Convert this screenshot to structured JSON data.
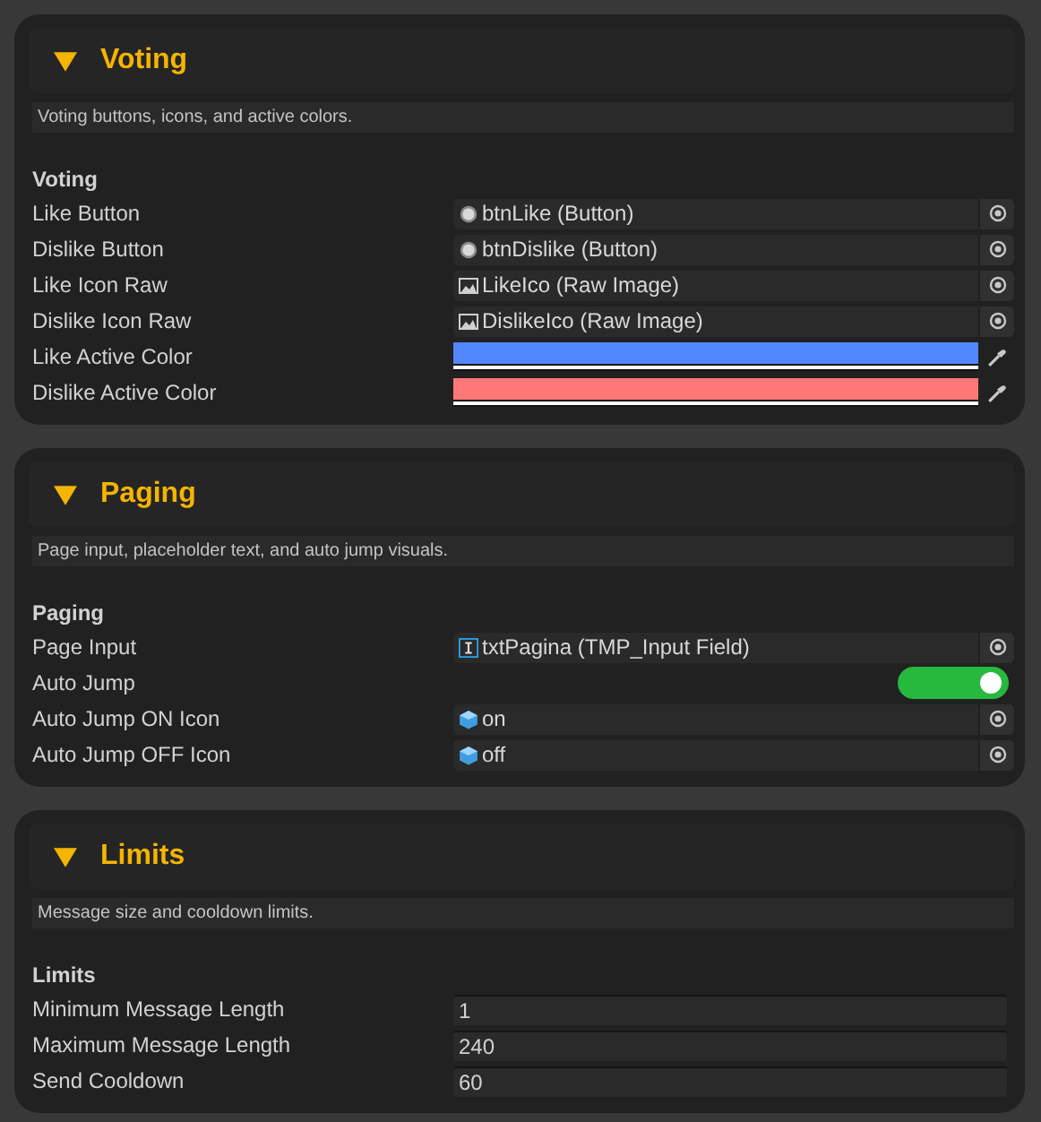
{
  "sections": [
    {
      "title": "Voting",
      "expanded": true,
      "description": "Voting buttons, icons, and active colors.",
      "group": "Voting",
      "rows": [
        {
          "label": "Like Button",
          "kind": "button_ref",
          "value": "btnLike (Button)"
        },
        {
          "label": "Dislike Button",
          "kind": "button_ref",
          "value": "btnDislike (Button)"
        },
        {
          "label": "Like Icon Raw",
          "kind": "image_ref",
          "value": "LikeIco (Raw Image)"
        },
        {
          "label": "Dislike Icon Raw",
          "kind": "image_ref",
          "value": "DislikeIco (Raw Image)"
        },
        {
          "label": "Like Active Color",
          "kind": "color",
          "color": "#5087ff"
        },
        {
          "label": "Dislike Active Color",
          "kind": "color",
          "color": "#ff7878"
        }
      ]
    },
    {
      "title": "Paging",
      "expanded": true,
      "description": "Page input, placeholder text, and auto jump visuals.",
      "group": "Paging",
      "rows": [
        {
          "label": "Page Input",
          "kind": "input_ref",
          "value": "txtPagina (TMP_Input Field)"
        },
        {
          "label": "Auto Jump",
          "kind": "toggle",
          "on": true
        },
        {
          "label": "Auto Jump ON Icon",
          "kind": "prefab_ref",
          "value": "on"
        },
        {
          "label": "Auto Jump OFF Icon",
          "kind": "prefab_ref",
          "value": "off"
        }
      ]
    },
    {
      "title": "Limits",
      "expanded": true,
      "description": "Message size and cooldown limits.",
      "group": "Limits",
      "rows": [
        {
          "label": "Minimum Message Length",
          "kind": "number",
          "value": "1"
        },
        {
          "label": "Maximum Message Length",
          "kind": "number",
          "value": "240"
        },
        {
          "label": "Send Cooldown",
          "kind": "number",
          "value": "60"
        }
      ]
    }
  ]
}
